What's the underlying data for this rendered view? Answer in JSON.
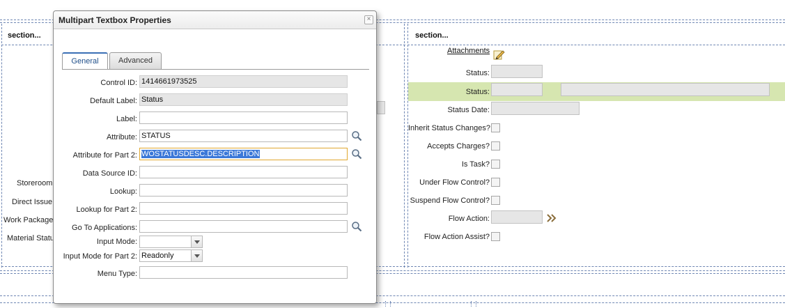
{
  "background": {
    "left_section": {
      "title": "section...",
      "labels": [
        "Storeroom",
        "Direct Issue",
        "Work Package",
        "Material Status"
      ]
    },
    "right_section": {
      "title": "section...",
      "attachments_link": "Attachments",
      "labels": {
        "status1": "Status:",
        "status2": "Status:",
        "status_date": "Status Date:",
        "inherit": "Inherit Status Changes?",
        "accepts": "Accepts Charges?",
        "is_task": "Is Task?",
        "under_flow": "Under Flow Control?",
        "suspend_flow": "Suspend Flow Control?",
        "flow_action": "Flow Action:",
        "flow_action_assist": "Flow Action Assist?"
      }
    }
  },
  "dialog": {
    "title": "Multipart Textbox Properties",
    "close_glyph": "×",
    "tabs": [
      {
        "label": "General",
        "active": true
      },
      {
        "label": "Advanced",
        "active": false
      }
    ],
    "fields": {
      "control_id": {
        "label": "Control ID:",
        "value": "1414661973525"
      },
      "default_label": {
        "label": "Default Label:",
        "value": "Status"
      },
      "label": {
        "label": "Label:",
        "value": ""
      },
      "attribute": {
        "label": "Attribute:",
        "value": "STATUS"
      },
      "attribute_part2": {
        "label": "Attribute for Part 2:",
        "value": "WOSTATUSDESC.DESCRIPTION"
      },
      "data_source_id": {
        "label": "Data Source ID:",
        "value": ""
      },
      "lookup": {
        "label": "Lookup:",
        "value": ""
      },
      "lookup_part2": {
        "label": "Lookup for Part 2:",
        "value": ""
      },
      "go_to_apps": {
        "label": "Go To Applications:",
        "value": ""
      },
      "input_mode": {
        "label": "Input Mode:",
        "value": ""
      },
      "input_mode_part2": {
        "label": "Input Mode for Part 2:",
        "value": "Readonly"
      },
      "menu_type": {
        "label": "Menu Type:",
        "value": ""
      }
    }
  },
  "colors": {
    "dashed_border": "#6e86b3",
    "highlight_row": "#d6e6b0",
    "active_tab_text": "#1f4f8a",
    "selection": "#3b78d8",
    "focus_border": "#e0a830"
  }
}
